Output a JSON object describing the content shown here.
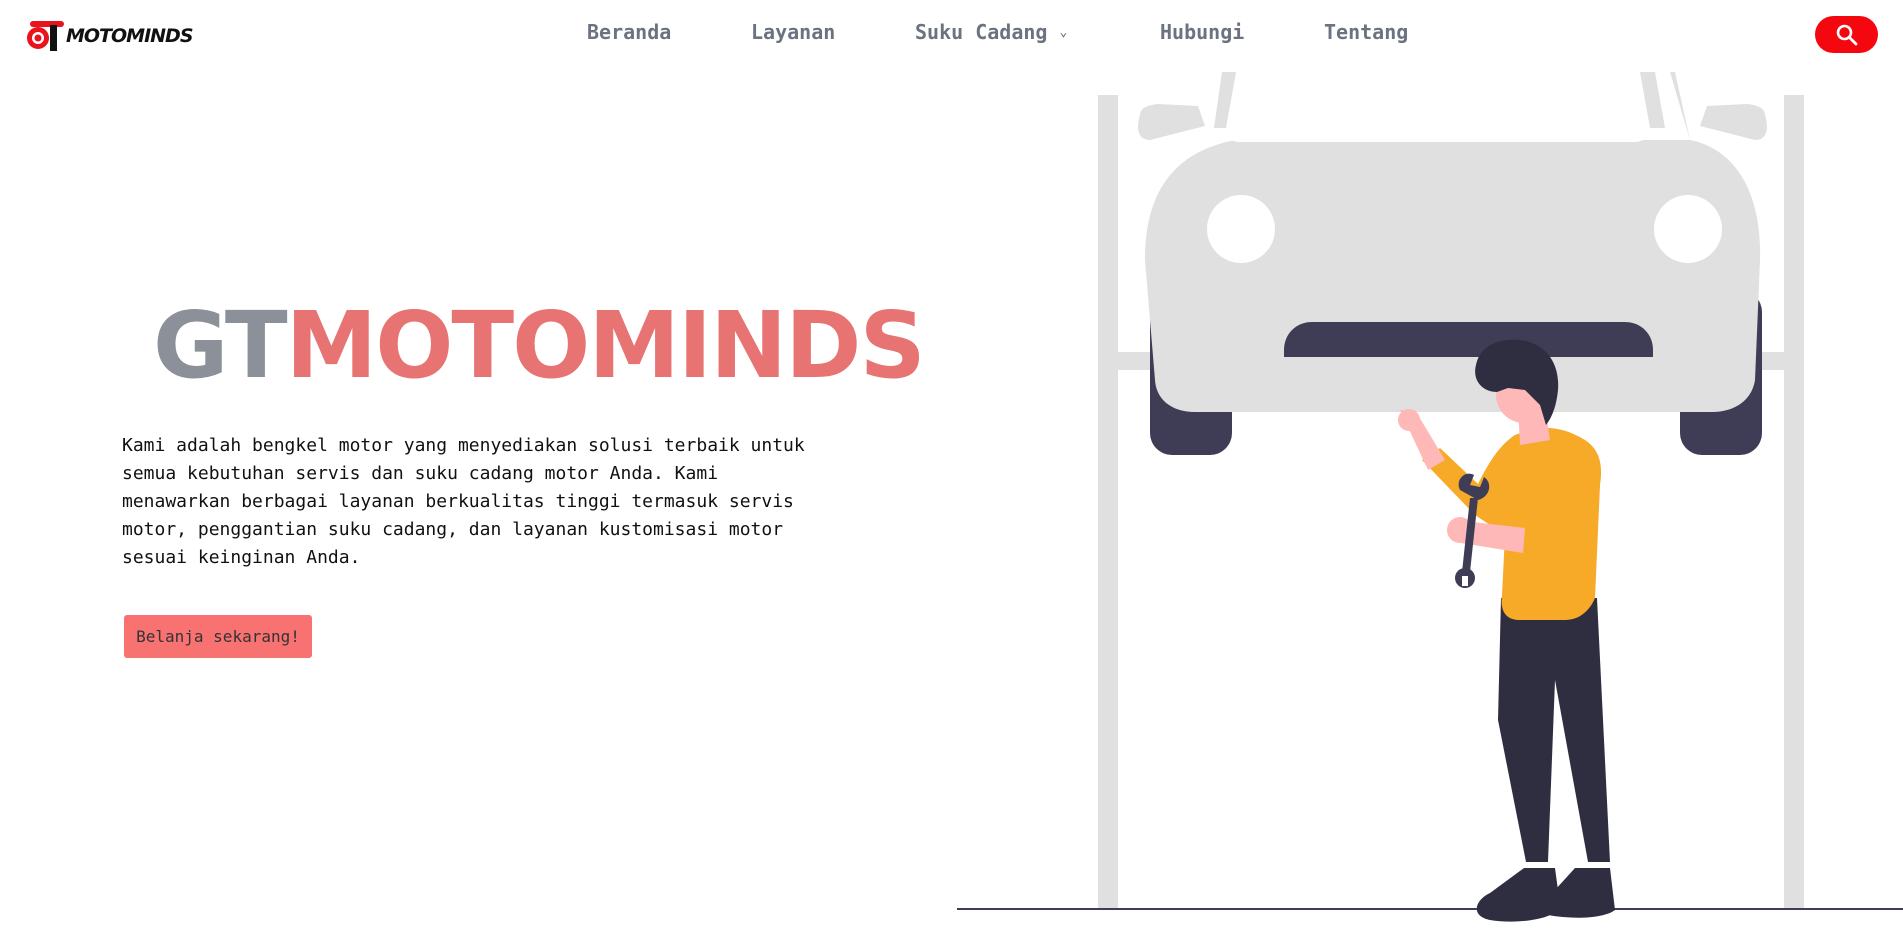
{
  "brand": {
    "logo_text_gt": "GT",
    "logo_text_rest": "MOTOMINDS",
    "color": "#e8131d"
  },
  "nav": {
    "items": [
      {
        "label": "Beranda"
      },
      {
        "label": "Layanan"
      },
      {
        "label": "Suku Cadang",
        "has_dropdown": true
      },
      {
        "label": "Hubungi"
      },
      {
        "label": "Tentang"
      }
    ],
    "search_icon": "search-icon"
  },
  "hero": {
    "title_part1": "GT",
    "title_part2": "MOTOMINDS",
    "description": "Kami adalah bengkel motor yang menyediakan solusi terbaik untuk semua kebutuhan servis dan suku cadang motor Anda. Kami menawarkan berbagai layanan berkualitas tinggi termasuk servis motor, penggantian suku cadang, dan layanan kustomisasi motor sesuai keinginan Anda.",
    "cta_label": "Belanja sekarang!"
  },
  "colors": {
    "accent": "#f5070f",
    "title_grey": "#8c9098",
    "title_red": "#e87373",
    "cta_bg": "#f87272",
    "nav_text": "#6b7280"
  }
}
